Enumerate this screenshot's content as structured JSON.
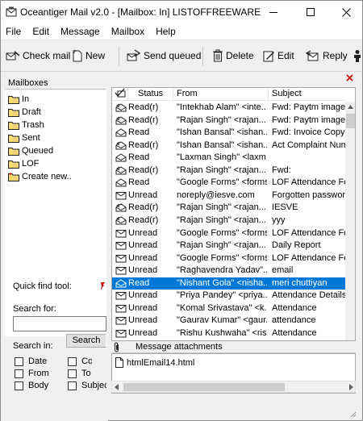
{
  "window": {
    "title": "Oceantiger Mail v2.0 - [Mailbox: In] LISTOFFREEWARE",
    "controls": [
      "minimize",
      "maximize",
      "close"
    ]
  },
  "menu": [
    "File",
    "Edit",
    "Message",
    "Mailbox",
    "Help"
  ],
  "toolbar": {
    "check_mail": "Check mail",
    "new": "New",
    "send_queued": "Send queued",
    "delete": "Delete",
    "edit": "Edit",
    "reply": "Reply"
  },
  "mailboxes": {
    "header": "Mailboxes",
    "folders": [
      "In",
      "Draft",
      "Trash",
      "Sent",
      "Queued",
      "LOF",
      "Create new.."
    ]
  },
  "quick_find": {
    "label": "Quick find tool:",
    "search_for_label": "Search for:",
    "search_value": "",
    "search_button": "Search",
    "search_in_label": "Search in:",
    "options": [
      {
        "label": "Date",
        "checked": false
      },
      {
        "label": "Cc",
        "checked": false
      },
      {
        "label": "From",
        "checked": false
      },
      {
        "label": "To",
        "checked": false
      },
      {
        "label": "Body",
        "checked": false
      },
      {
        "label": "Subject",
        "checked": false
      }
    ]
  },
  "messages": {
    "columns": [
      "Status",
      "From",
      "Subject"
    ],
    "rows": [
      {
        "icon": "read-reply",
        "status": "Read(r)",
        "from": "\"Intekhab Alam\" <inte...",
        "subject": "Fwd: Paytm image"
      },
      {
        "icon": "read-reply",
        "status": "Read(r)",
        "from": "\"Rajan Singh\" <rajan...",
        "subject": "Fwd: Paytm image"
      },
      {
        "icon": "read",
        "status": "Read",
        "from": "\"Ishan Bansal\" <ishan...",
        "subject": "Fwd: Invoice Copy and"
      },
      {
        "icon": "read-reply",
        "status": "Read(r)",
        "from": "\"Ishan Bansal\" <ishan...",
        "subject": "Act Complaint Numbe"
      },
      {
        "icon": "read",
        "status": "Read",
        "from": "\"Laxman Singh\" <laxm...",
        "subject": ""
      },
      {
        "icon": "read-reply",
        "status": "Read(r)",
        "from": "\"Rajan Singh\" <rajan...",
        "subject": "Fwd:"
      },
      {
        "icon": "read",
        "status": "Read",
        "from": "\"Google Forms\" <forms...",
        "subject": "LOF Attendance Form"
      },
      {
        "icon": "unread",
        "status": "Unread",
        "from": "noreply@iesve.com",
        "subject": "Forgotten password o"
      },
      {
        "icon": "read-reply",
        "status": "Read(r)",
        "from": "\"Rajan Singh\" <rajan...",
        "subject": "IESVE"
      },
      {
        "icon": "read-reply",
        "status": "Read(r)",
        "from": "\"Rajan Singh\" <rajan...",
        "subject": "yyy"
      },
      {
        "icon": "unread",
        "status": "Unread",
        "from": "\"Google Forms\" <forms...",
        "subject": "LOF Attendance Form"
      },
      {
        "icon": "unread",
        "status": "Unread",
        "from": "\"Rajan Singh\" <rajan...",
        "subject": "Daily Report"
      },
      {
        "icon": "unread",
        "status": "Unread",
        "from": "\"Google Forms\" <forms...",
        "subject": "LOF Attendance Form"
      },
      {
        "icon": "unread",
        "status": "Unread",
        "from": "\"Raghavendra Yadav\"...",
        "subject": "email"
      },
      {
        "icon": "read",
        "status": "Read",
        "from": "\"Nishant Gola\" <nisha...",
        "subject": "meri chuttiyan",
        "selected": true
      },
      {
        "icon": "unread",
        "status": "Unread",
        "from": "\"Priya Pandey\" <priya...",
        "subject": "Attendance Details"
      },
      {
        "icon": "unread",
        "status": "Unread",
        "from": "\"Komal Srivastava\" <k...",
        "subject": "Attendance"
      },
      {
        "icon": "unread",
        "status": "Unread",
        "from": "\"Gaurav Kumar\" <gaur...",
        "subject": "attendance"
      },
      {
        "icon": "unread",
        "status": "Unread",
        "from": "\"Rishu Kushwaha\" <ris...",
        "subject": "Attendance"
      }
    ]
  },
  "attachments": {
    "header": "Message attachments",
    "items": [
      "htmlEmail14.html"
    ]
  }
}
